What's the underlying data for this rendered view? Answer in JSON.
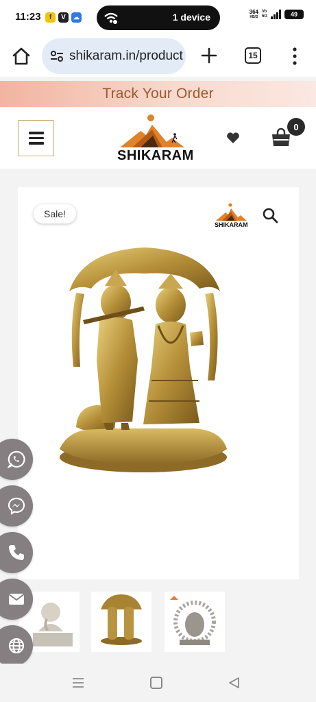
{
  "status_bar": {
    "time": "11:23",
    "apps": [
      {
        "name": "flipkart-icon",
        "glyph": "f",
        "color": "#f5c400"
      },
      {
        "name": "v-app-icon",
        "glyph": "V",
        "color": "#222222"
      },
      {
        "name": "cloud-app-icon",
        "glyph": "☁",
        "color": "#2f7ae5"
      }
    ],
    "pill_text": "1 device",
    "speed_value": "364",
    "speed_unit": "KB/S",
    "network_top": "Vo",
    "network_bottom": "5G",
    "battery": "49"
  },
  "browser": {
    "url": "shikaram.in/product",
    "tab_count": "15"
  },
  "banner": {
    "text": "Track Your Order"
  },
  "header": {
    "logo_text": "SHIKARAM",
    "cart_count": "0"
  },
  "product": {
    "sale_label": "Sale!",
    "watermark_text": "SHIKARAM"
  },
  "thumbnails": [
    {
      "name": "thumbnail-ganesha"
    },
    {
      "name": "thumbnail-radha-krishna"
    },
    {
      "name": "thumbnail-ganesha-ring"
    }
  ],
  "float_buttons": [
    {
      "name": "whatsapp-button",
      "icon": "whatsapp-icon"
    },
    {
      "name": "messenger-button",
      "icon": "messenger-icon"
    },
    {
      "name": "phone-button",
      "icon": "phone-icon"
    },
    {
      "name": "email-button",
      "icon": "mail-icon"
    },
    {
      "name": "website-button",
      "icon": "globe-icon"
    }
  ],
  "colors": {
    "banner_text": "#9b5a30",
    "accent_gold": "#c9a96b",
    "float_button": "#857f81",
    "logo_orange": "#e0822b"
  }
}
